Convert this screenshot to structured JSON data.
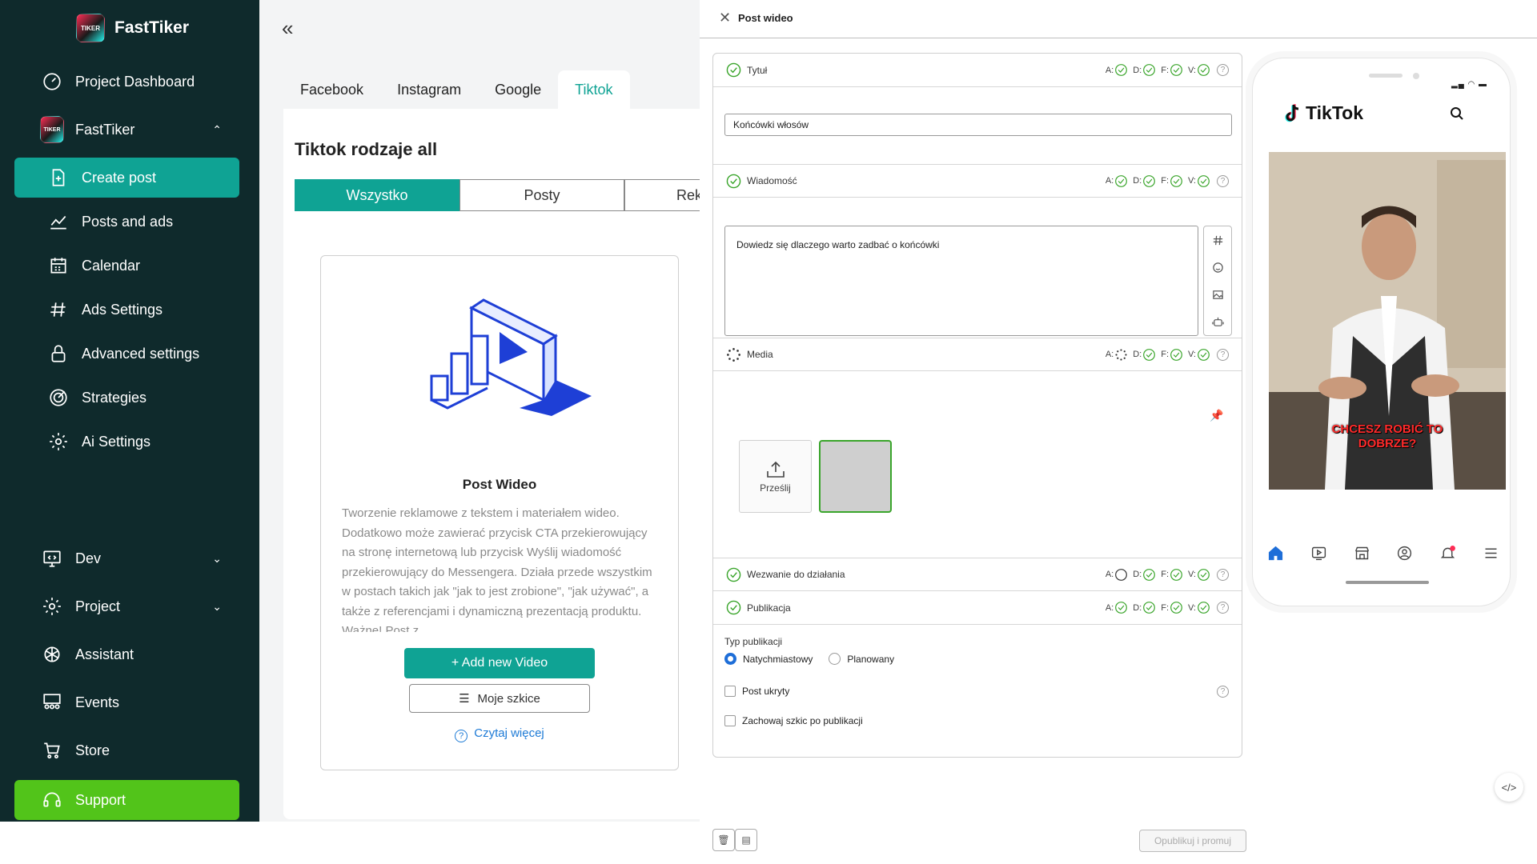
{
  "brand": {
    "name": "FastTiker",
    "logo_text": "TIKER"
  },
  "sidebar": {
    "items": [
      {
        "label": "Project Dashboard"
      },
      {
        "label": "FastTiker"
      },
      {
        "label": "Create post"
      },
      {
        "label": "Posts and ads"
      },
      {
        "label": "Calendar"
      },
      {
        "label": "Ads Settings"
      },
      {
        "label": "Advanced settings"
      },
      {
        "label": "Strategies"
      },
      {
        "label": "Ai Settings"
      },
      {
        "label": "Dev"
      },
      {
        "label": "Project"
      },
      {
        "label": "Assistant"
      },
      {
        "label": "Events"
      },
      {
        "label": "Store"
      },
      {
        "label": "Support"
      }
    ],
    "colors": {
      "bg": "#0f2a2c",
      "active": "#0fa394",
      "support": "#52c41a"
    }
  },
  "platform_tabs": [
    "Facebook",
    "Instagram",
    "Google",
    "Tiktok"
  ],
  "middle": {
    "title": "Tiktok rodzaje all",
    "segments": [
      "Wszystko",
      "Posty",
      "Rek"
    ],
    "card": {
      "title": "Post Wideo",
      "description": "Tworzenie reklamowe z tekstem i materiałem wideo. Dodatkowo może zawierać przycisk CTA przekierowujący na stronę internetową lub przycisk Wyślij wiadomość przekierowujący do Messengera. Działa przede wszystkim w postach takich jak \"jak to jest zrobione\", \"jak używać\", a także z referencjami i dynamiczną prezentacją produktu. Ważne! Post z",
      "add_button": "+ Add new Video",
      "drafts_button": "Moje szkice",
      "read_more": "Czytaj więcej"
    }
  },
  "form": {
    "header_title": "Post wideo",
    "flag_letters": [
      "A:",
      "D:",
      "F:",
      "V:"
    ],
    "sections": {
      "title": {
        "label": "Tytuł",
        "value": "Końcówki włosów"
      },
      "message": {
        "label": "Wiadomość",
        "value": "Dowiedz się dlaczego warto zadbać o końcówki"
      },
      "media": {
        "label": "Media",
        "upload_label": "Prześlij"
      },
      "cta": {
        "label": "Wezwanie do działania"
      },
      "publication": {
        "label": "Publikacja",
        "type_label": "Typ publikacji",
        "options": [
          "Natychmiastowy",
          "Planowany"
        ],
        "hidden_post": "Post ukryty",
        "keep_draft": "Zachowaj szkic po publikacji"
      }
    },
    "publish_button": "Opublikuj i promuj"
  },
  "preview": {
    "app_name": "TikTok",
    "caption_line1": "CHCESZ ROBIĆ TO",
    "caption_line2": "DOBRZE?"
  }
}
